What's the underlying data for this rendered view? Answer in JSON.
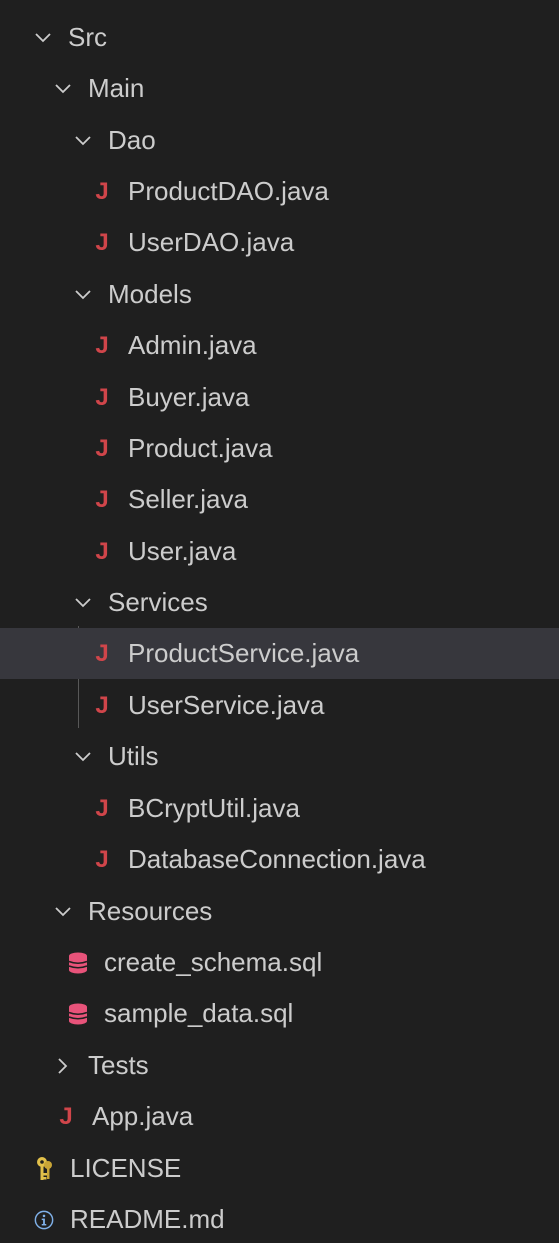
{
  "explorer": {
    "rows": [
      {
        "label": "Src",
        "kind": "folder",
        "expanded": true
      },
      {
        "label": "Main",
        "kind": "folder",
        "expanded": true
      },
      {
        "label": "Dao",
        "kind": "folder",
        "expanded": true
      },
      {
        "label": "ProductDAO.java",
        "kind": "java"
      },
      {
        "label": "UserDAO.java",
        "kind": "java"
      },
      {
        "label": "Models",
        "kind": "folder",
        "expanded": true
      },
      {
        "label": "Admin.java",
        "kind": "java"
      },
      {
        "label": "Buyer.java",
        "kind": "java"
      },
      {
        "label": "Product.java",
        "kind": "java"
      },
      {
        "label": "Seller.java",
        "kind": "java"
      },
      {
        "label": "User.java",
        "kind": "java"
      },
      {
        "label": "Services",
        "kind": "folder",
        "expanded": true
      },
      {
        "label": "ProductService.java",
        "kind": "java",
        "selected": true
      },
      {
        "label": "UserService.java",
        "kind": "java"
      },
      {
        "label": "Utils",
        "kind": "folder",
        "expanded": true
      },
      {
        "label": "BCryptUtil.java",
        "kind": "java"
      },
      {
        "label": "DatabaseConnection.java",
        "kind": "java"
      },
      {
        "label": "Resources",
        "kind": "folder",
        "expanded": true
      },
      {
        "label": "create_schema.sql",
        "kind": "sql"
      },
      {
        "label": "sample_data.sql",
        "kind": "sql"
      },
      {
        "label": "Tests",
        "kind": "folder",
        "expanded": false
      },
      {
        "label": "App.java",
        "kind": "java"
      },
      {
        "label": "LICENSE",
        "kind": "license"
      },
      {
        "label": "README.md",
        "kind": "info"
      }
    ],
    "java_icon_glyph": "J",
    "colors": {
      "background": "#1f1f1f",
      "selected_row": "#37373d",
      "text": "#cccccc",
      "java_icon": "#d0454a",
      "sql_icon": "#e8537a",
      "license_icon": "#e2c04a",
      "info_icon": "#7fb0e8"
    }
  }
}
